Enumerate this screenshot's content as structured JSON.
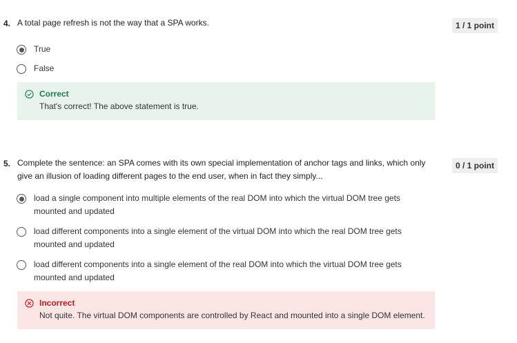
{
  "questions": [
    {
      "number": "4.",
      "text": "A total page refresh is not the way that a SPA works.",
      "points": "1 / 1 point",
      "options": [
        {
          "label": "True",
          "selected": true
        },
        {
          "label": "False",
          "selected": false
        }
      ],
      "feedback": {
        "status": "correct",
        "title": "Correct",
        "message": "That's correct! The above statement is true."
      }
    },
    {
      "number": "5.",
      "text": "Complete the sentence: an SPA comes with its own special implementation of anchor tags and links, which only give an illusion of loading different pages to the end user, when in fact they simply...",
      "points": "0 / 1 point",
      "options": [
        {
          "label": "load a single component into multiple elements of the real DOM into which the virtual DOM tree gets mounted and updated",
          "selected": true
        },
        {
          "label": "load different components into a single element of the virtual DOM into which the real DOM tree gets mounted and updated",
          "selected": false
        },
        {
          "label": "load different components into a single element of the real DOM into which the virtual DOM tree gets mounted and updated",
          "selected": false
        }
      ],
      "feedback": {
        "status": "incorrect",
        "title": "Incorrect",
        "message": "Not quite. The virtual DOM components are controlled by React and mounted into a single DOM element."
      }
    }
  ],
  "colors": {
    "correct": "#1e7a4e",
    "incorrect": "#c5181c",
    "correct_bg": "#e8f3ee",
    "incorrect_bg": "#fbe5e5"
  },
  "icons": {
    "correct": "check-circle-icon",
    "incorrect": "x-circle-icon"
  }
}
